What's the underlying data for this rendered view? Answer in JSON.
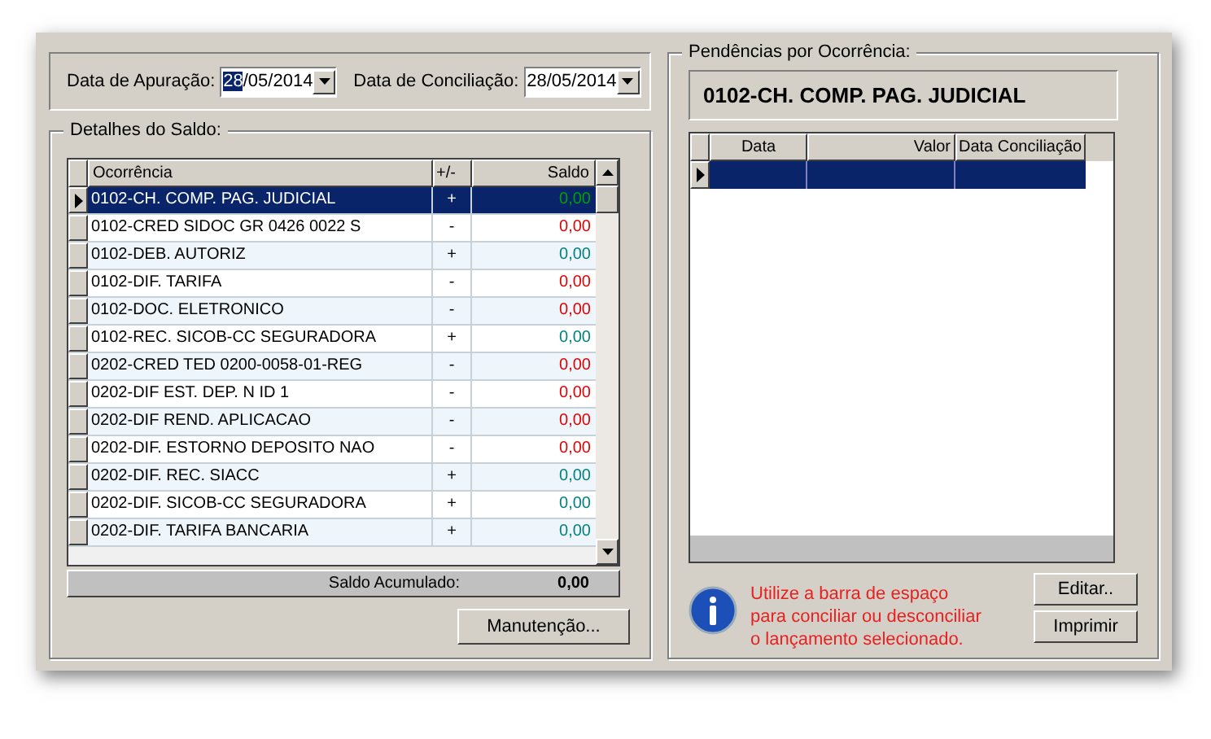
{
  "dates": [
    {
      "label": "Data de Apuração:",
      "parts": [
        {
          "text": "28",
          "selected": true
        },
        {
          "text": "/05/2014",
          "selected": false
        }
      ]
    },
    {
      "label": "Data de Conciliação:",
      "parts": [
        {
          "text": "28/05/2014",
          "selected": false
        }
      ]
    }
  ],
  "saldo_group": {
    "title": "Detalhes do Saldo:",
    "columns": [
      "Ocorrência",
      "+/-",
      "Saldo"
    ],
    "rows": [
      {
        "ocorrencia": "0102-CH. COMP. PAG. JUDICIAL",
        "sign": "+",
        "saldo": "0,00",
        "color": "#00a000",
        "selected": true
      },
      {
        "ocorrencia": "0102-CRED SIDOC GR 0426 0022 S",
        "sign": "-",
        "saldo": "0,00",
        "color": "#e00000",
        "selected": false
      },
      {
        "ocorrencia": "0102-DEB. AUTORIZ",
        "sign": "+",
        "saldo": "0,00",
        "color": "#008080",
        "selected": false
      },
      {
        "ocorrencia": "0102-DIF. TARIFA",
        "sign": "-",
        "saldo": "0,00",
        "color": "#e00000",
        "selected": false
      },
      {
        "ocorrencia": "0102-DOC. ELETRONICO",
        "sign": "-",
        "saldo": "0,00",
        "color": "#e00000",
        "selected": false
      },
      {
        "ocorrencia": "0102-REC. SICOB-CC SEGURADORA",
        "sign": "+",
        "saldo": "0,00",
        "color": "#008080",
        "selected": false
      },
      {
        "ocorrencia": "0202-CRED TED 0200-0058-01-REG",
        "sign": "-",
        "saldo": "0,00",
        "color": "#e00000",
        "selected": false
      },
      {
        "ocorrencia": "0202-DIF EST. DEP. N ID 1",
        "sign": "-",
        "saldo": "0,00",
        "color": "#e00000",
        "selected": false
      },
      {
        "ocorrencia": "0202-DIF REND. APLICACAO",
        "sign": "-",
        "saldo": "0,00",
        "color": "#e00000",
        "selected": false
      },
      {
        "ocorrencia": "0202-DIF. ESTORNO DEPOSITO NAO",
        "sign": "-",
        "saldo": "0,00",
        "color": "#e00000",
        "selected": false
      },
      {
        "ocorrencia": "0202-DIF. REC. SIACC",
        "sign": "+",
        "saldo": "0,00",
        "color": "#008080",
        "selected": false
      },
      {
        "ocorrencia": "0202-DIF. SICOB-CC SEGURADORA",
        "sign": "+",
        "saldo": "0,00",
        "color": "#008080",
        "selected": false
      },
      {
        "ocorrencia": "0202-DIF. TARIFA BANCARIA",
        "sign": "+",
        "saldo": "0,00",
        "color": "#008080",
        "selected": false
      }
    ],
    "total_label": "Saldo Acumulado:",
    "total_value": "0,00",
    "button": "Manutenção..."
  },
  "pendencias_group": {
    "title": "Pendências por Ocorrência:",
    "heading": "0102-CH. COMP. PAG. JUDICIAL",
    "columns": [
      "Data",
      "Valor",
      "Data Conciliação"
    ],
    "rows": [
      {
        "selected": true
      }
    ],
    "hint": "Utilize a barra de espaço para conciliar ou desconciliar o lançamento selecionado.",
    "buttons": [
      "Editar..",
      "Imprimir"
    ]
  }
}
